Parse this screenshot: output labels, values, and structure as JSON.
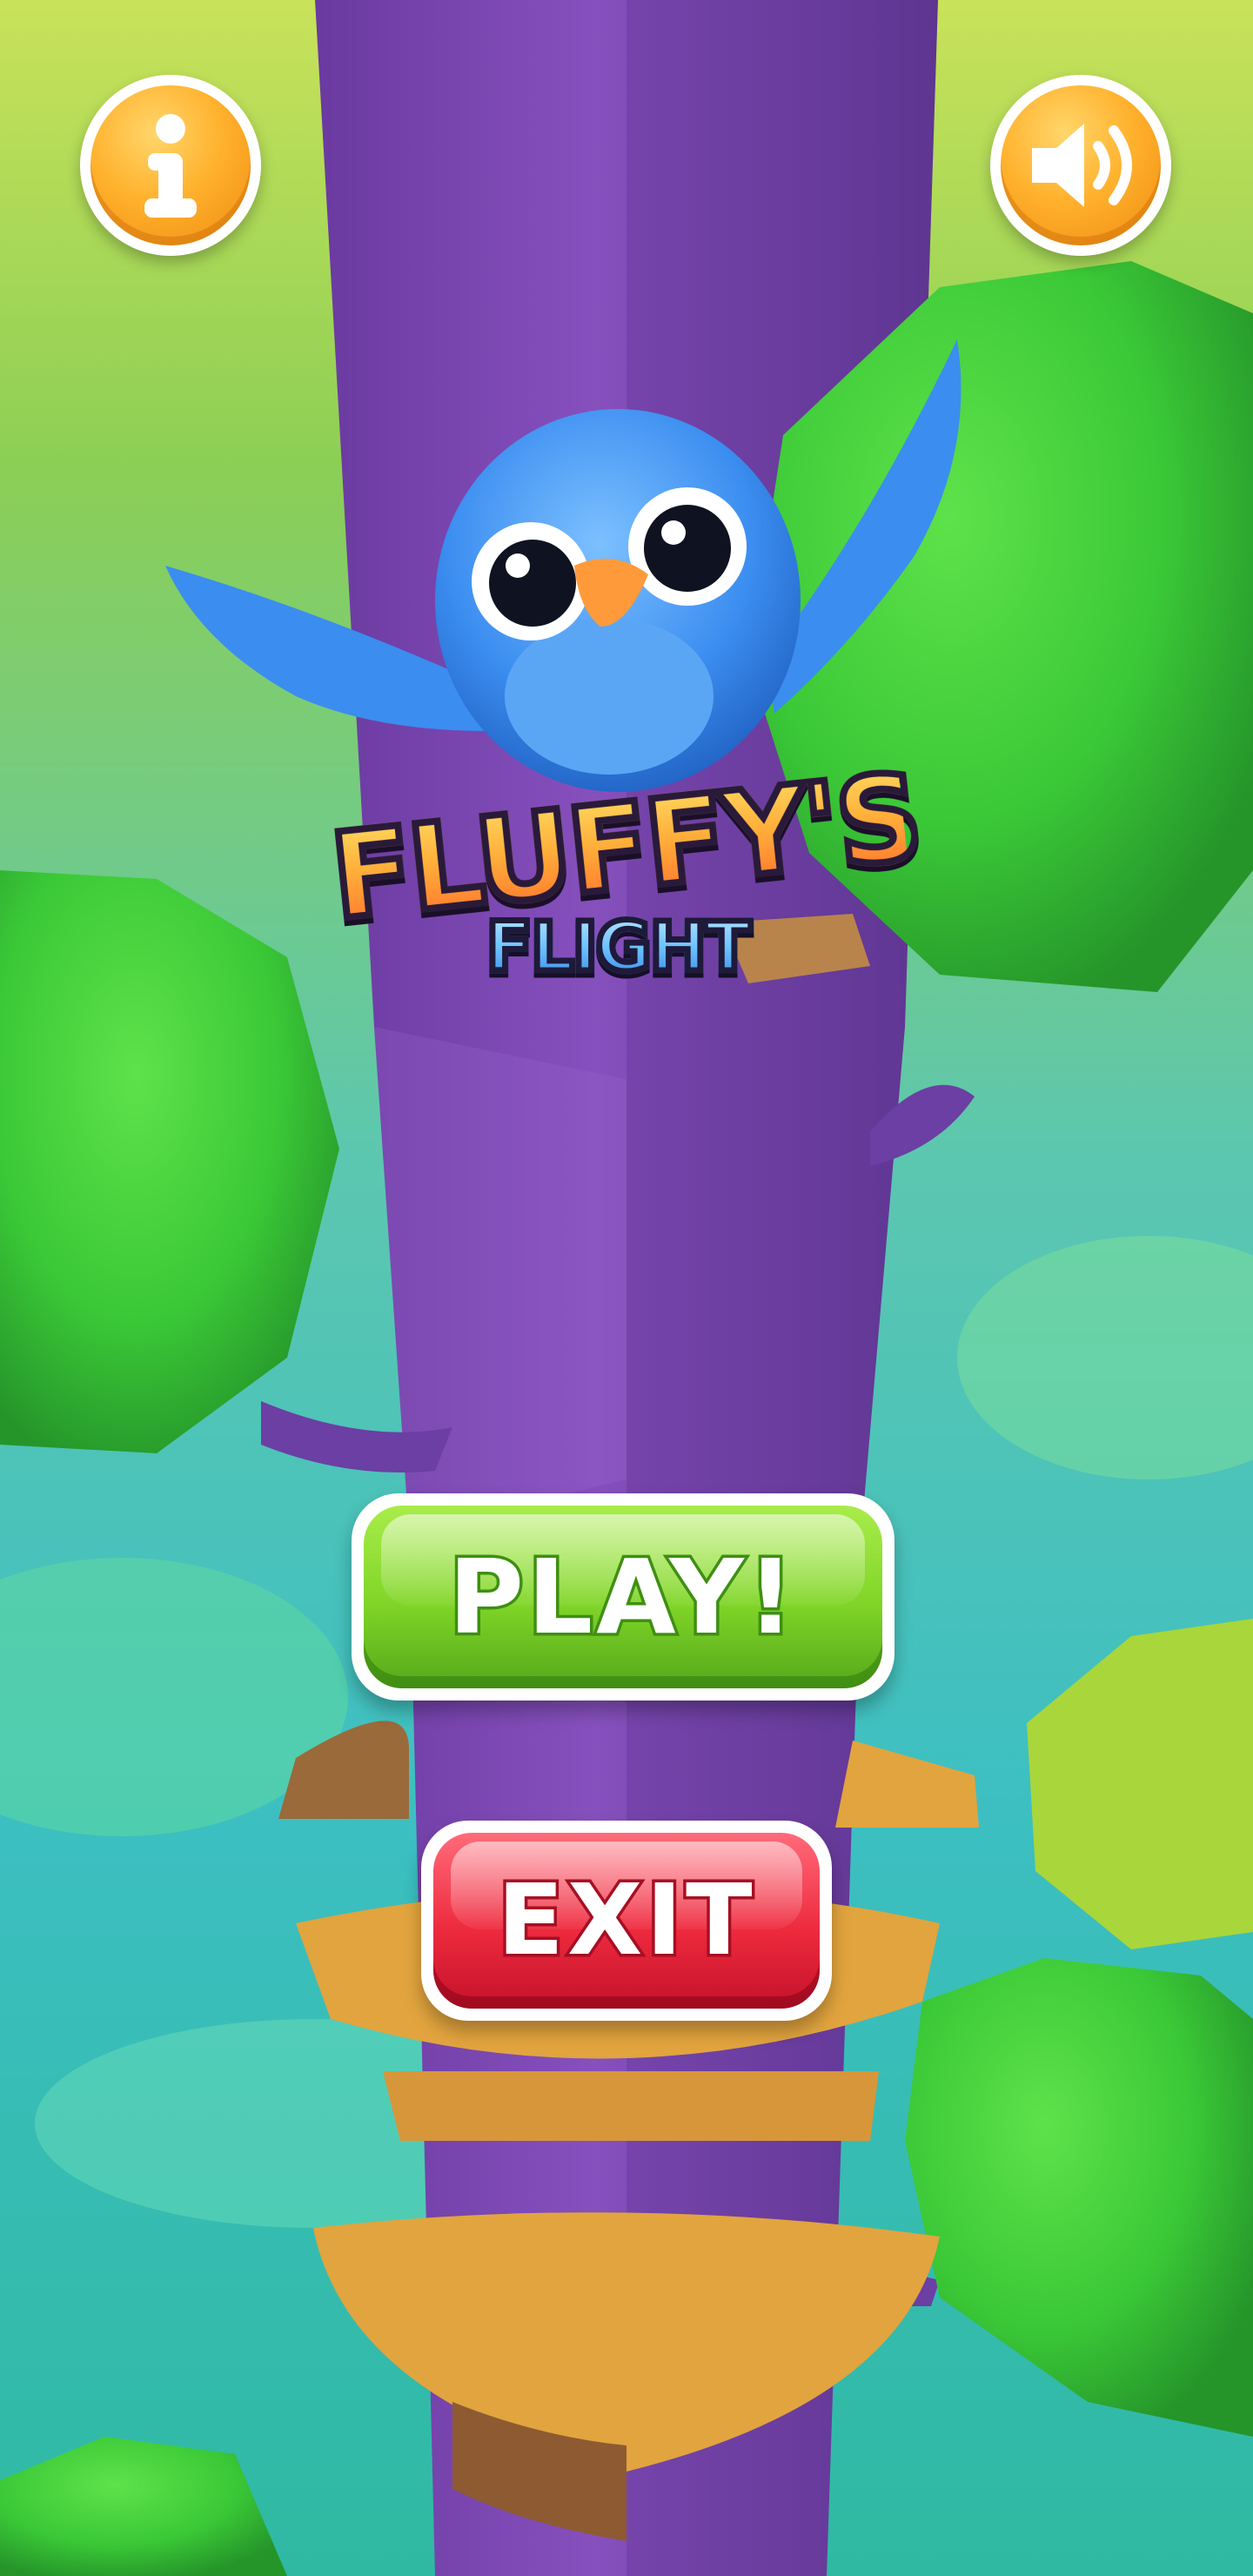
{
  "game": {
    "title": "FLUFFY'S",
    "subtitle": "FLIGHT"
  },
  "menu": {
    "play_label": "PLAY!",
    "exit_label": "EXIT"
  },
  "icons": {
    "info": "info-icon",
    "sound": "speaker-volume-icon"
  },
  "colors": {
    "tower": "#7d4bb0",
    "foliage": "#3fcf3a",
    "platform": "#e2a43e",
    "bird": "#3b8df0",
    "icon_button": "#ffad2a",
    "play_button": "#7fd427",
    "exit_button": "#ee2a3e"
  }
}
